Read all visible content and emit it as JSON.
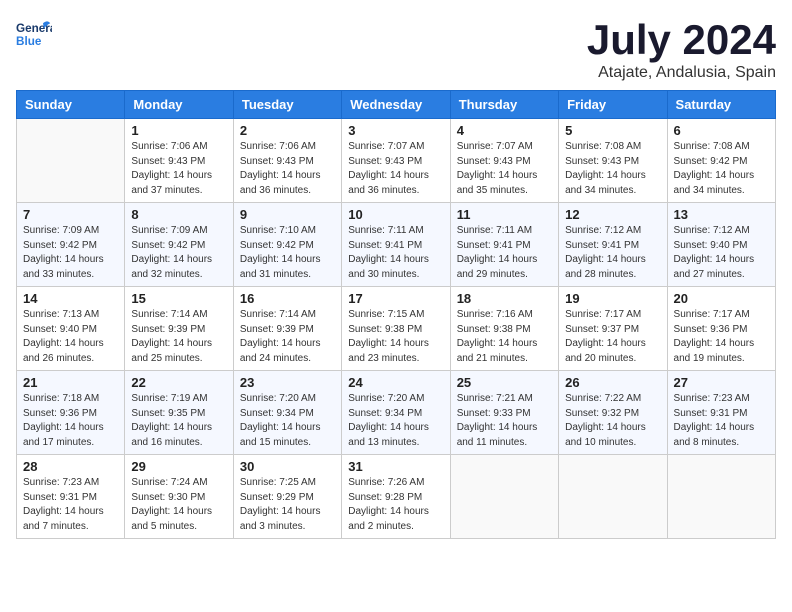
{
  "header": {
    "logo_general": "General",
    "logo_blue": "Blue",
    "month_title": "July 2024",
    "location": "Atajate, Andalusia, Spain"
  },
  "columns": [
    "Sunday",
    "Monday",
    "Tuesday",
    "Wednesday",
    "Thursday",
    "Friday",
    "Saturday"
  ],
  "weeks": [
    [
      {
        "day": "",
        "info": ""
      },
      {
        "day": "1",
        "info": "Sunrise: 7:06 AM\nSunset: 9:43 PM\nDaylight: 14 hours\nand 37 minutes."
      },
      {
        "day": "2",
        "info": "Sunrise: 7:06 AM\nSunset: 9:43 PM\nDaylight: 14 hours\nand 36 minutes."
      },
      {
        "day": "3",
        "info": "Sunrise: 7:07 AM\nSunset: 9:43 PM\nDaylight: 14 hours\nand 36 minutes."
      },
      {
        "day": "4",
        "info": "Sunrise: 7:07 AM\nSunset: 9:43 PM\nDaylight: 14 hours\nand 35 minutes."
      },
      {
        "day": "5",
        "info": "Sunrise: 7:08 AM\nSunset: 9:43 PM\nDaylight: 14 hours\nand 34 minutes."
      },
      {
        "day": "6",
        "info": "Sunrise: 7:08 AM\nSunset: 9:42 PM\nDaylight: 14 hours\nand 34 minutes."
      }
    ],
    [
      {
        "day": "7",
        "info": "Sunrise: 7:09 AM\nSunset: 9:42 PM\nDaylight: 14 hours\nand 33 minutes."
      },
      {
        "day": "8",
        "info": "Sunrise: 7:09 AM\nSunset: 9:42 PM\nDaylight: 14 hours\nand 32 minutes."
      },
      {
        "day": "9",
        "info": "Sunrise: 7:10 AM\nSunset: 9:42 PM\nDaylight: 14 hours\nand 31 minutes."
      },
      {
        "day": "10",
        "info": "Sunrise: 7:11 AM\nSunset: 9:41 PM\nDaylight: 14 hours\nand 30 minutes."
      },
      {
        "day": "11",
        "info": "Sunrise: 7:11 AM\nSunset: 9:41 PM\nDaylight: 14 hours\nand 29 minutes."
      },
      {
        "day": "12",
        "info": "Sunrise: 7:12 AM\nSunset: 9:41 PM\nDaylight: 14 hours\nand 28 minutes."
      },
      {
        "day": "13",
        "info": "Sunrise: 7:12 AM\nSunset: 9:40 PM\nDaylight: 14 hours\nand 27 minutes."
      }
    ],
    [
      {
        "day": "14",
        "info": "Sunrise: 7:13 AM\nSunset: 9:40 PM\nDaylight: 14 hours\nand 26 minutes."
      },
      {
        "day": "15",
        "info": "Sunrise: 7:14 AM\nSunset: 9:39 PM\nDaylight: 14 hours\nand 25 minutes."
      },
      {
        "day": "16",
        "info": "Sunrise: 7:14 AM\nSunset: 9:39 PM\nDaylight: 14 hours\nand 24 minutes."
      },
      {
        "day": "17",
        "info": "Sunrise: 7:15 AM\nSunset: 9:38 PM\nDaylight: 14 hours\nand 23 minutes."
      },
      {
        "day": "18",
        "info": "Sunrise: 7:16 AM\nSunset: 9:38 PM\nDaylight: 14 hours\nand 21 minutes."
      },
      {
        "day": "19",
        "info": "Sunrise: 7:17 AM\nSunset: 9:37 PM\nDaylight: 14 hours\nand 20 minutes."
      },
      {
        "day": "20",
        "info": "Sunrise: 7:17 AM\nSunset: 9:36 PM\nDaylight: 14 hours\nand 19 minutes."
      }
    ],
    [
      {
        "day": "21",
        "info": "Sunrise: 7:18 AM\nSunset: 9:36 PM\nDaylight: 14 hours\nand 17 minutes."
      },
      {
        "day": "22",
        "info": "Sunrise: 7:19 AM\nSunset: 9:35 PM\nDaylight: 14 hours\nand 16 minutes."
      },
      {
        "day": "23",
        "info": "Sunrise: 7:20 AM\nSunset: 9:34 PM\nDaylight: 14 hours\nand 15 minutes."
      },
      {
        "day": "24",
        "info": "Sunrise: 7:20 AM\nSunset: 9:34 PM\nDaylight: 14 hours\nand 13 minutes."
      },
      {
        "day": "25",
        "info": "Sunrise: 7:21 AM\nSunset: 9:33 PM\nDaylight: 14 hours\nand 11 minutes."
      },
      {
        "day": "26",
        "info": "Sunrise: 7:22 AM\nSunset: 9:32 PM\nDaylight: 14 hours\nand 10 minutes."
      },
      {
        "day": "27",
        "info": "Sunrise: 7:23 AM\nSunset: 9:31 PM\nDaylight: 14 hours\nand 8 minutes."
      }
    ],
    [
      {
        "day": "28",
        "info": "Sunrise: 7:23 AM\nSunset: 9:31 PM\nDaylight: 14 hours\nand 7 minutes."
      },
      {
        "day": "29",
        "info": "Sunrise: 7:24 AM\nSunset: 9:30 PM\nDaylight: 14 hours\nand 5 minutes."
      },
      {
        "day": "30",
        "info": "Sunrise: 7:25 AM\nSunset: 9:29 PM\nDaylight: 14 hours\nand 3 minutes."
      },
      {
        "day": "31",
        "info": "Sunrise: 7:26 AM\nSunset: 9:28 PM\nDaylight: 14 hours\nand 2 minutes."
      },
      {
        "day": "",
        "info": ""
      },
      {
        "day": "",
        "info": ""
      },
      {
        "day": "",
        "info": ""
      }
    ]
  ]
}
